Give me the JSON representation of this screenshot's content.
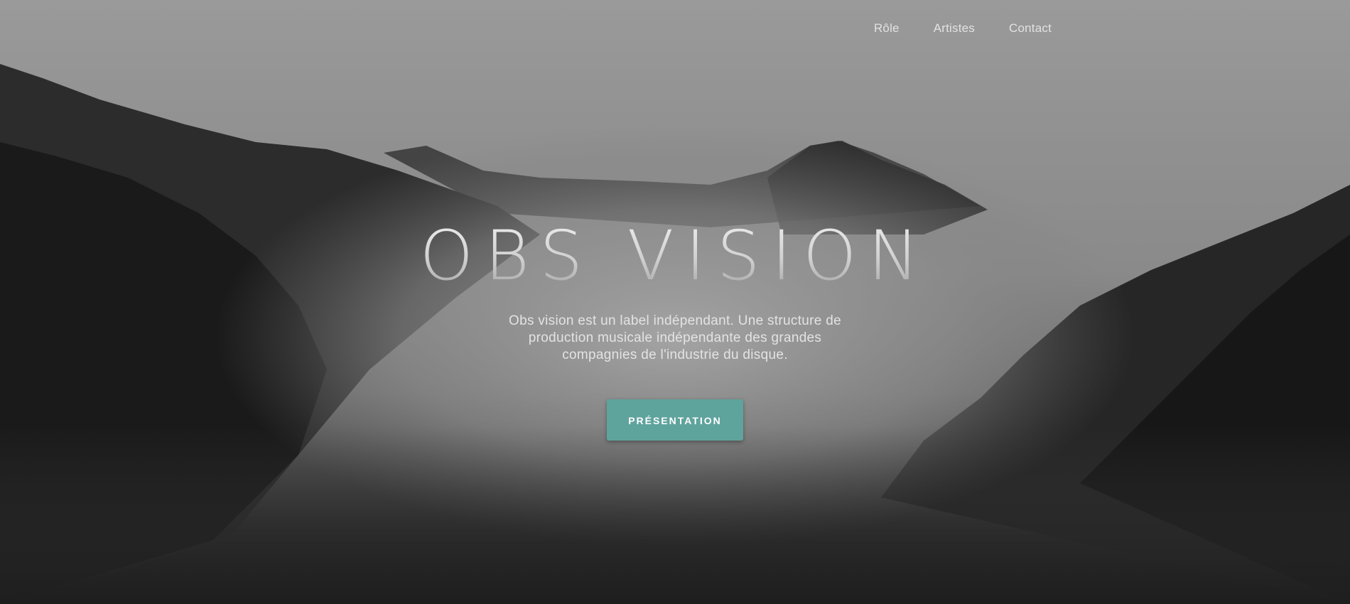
{
  "nav": {
    "items": [
      {
        "label": "Rôle"
      },
      {
        "label": "Artistes"
      },
      {
        "label": "Contact"
      }
    ]
  },
  "hero": {
    "title": "OBS VISION",
    "tagline": "Obs vision est un label indépendant. Une structure de production musicale indépendante des grandes compagnies de l'industrie du disque.",
    "cta_label": "PRÉSENTATION",
    "background": "misty-forest-mountains-image"
  },
  "colors": {
    "accent": "#5fa39d",
    "nav_text": "#e2e2e2"
  }
}
